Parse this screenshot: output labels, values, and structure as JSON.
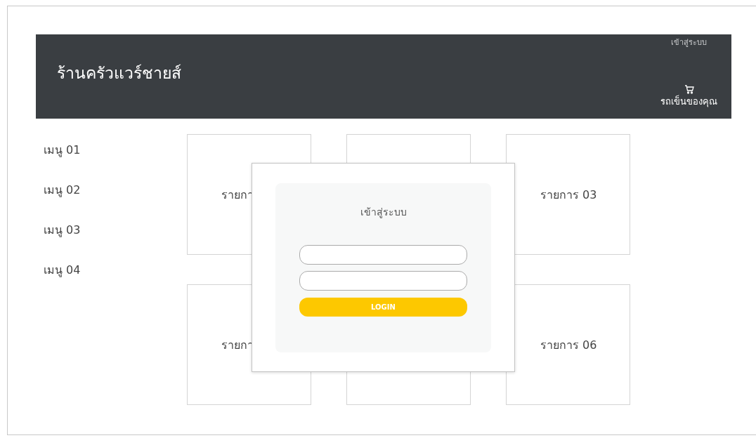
{
  "header": {
    "title": "ร้านครัวแวร์ชายส์",
    "login_link": "เข้าสู่ระบบ",
    "cart_label": "รถเข็นของคุณ"
  },
  "sidebar": {
    "items": [
      {
        "label": "เมนู 01"
      },
      {
        "label": "เมนู 02"
      },
      {
        "label": "เมนู 03"
      },
      {
        "label": "เมนู 04"
      }
    ]
  },
  "products": [
    {
      "kind": "labeled",
      "label": "รายกา"
    },
    {
      "kind": "covered"
    },
    {
      "kind": "labeled",
      "label": "รายการ 03"
    },
    {
      "kind": "labeled",
      "label": "รายกา"
    },
    {
      "kind": "covered"
    },
    {
      "kind": "labeled",
      "label": "รายการ 06"
    }
  ],
  "login_dialog": {
    "title": "เข้าสู่ระบบ",
    "button": "LOGIN"
  }
}
